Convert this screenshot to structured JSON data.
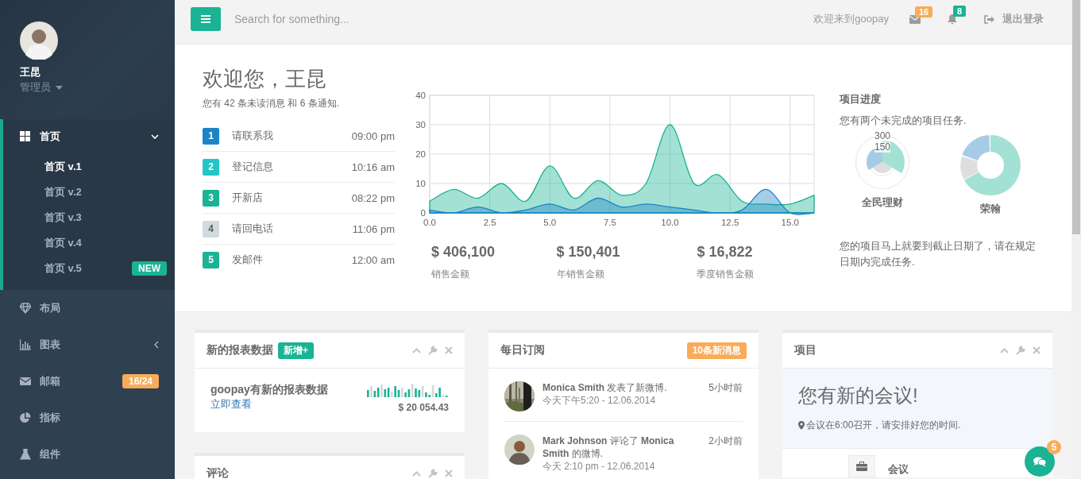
{
  "sidebar": {
    "profile": {
      "name": "王昆",
      "role": "管理员"
    },
    "menu": [
      {
        "label": "首页",
        "selected": true,
        "expanded": true,
        "children": [
          {
            "label": "首页 v.1",
            "selected": true
          },
          {
            "label": "首页 v.2",
            "selected": false
          },
          {
            "label": "首页 v.3",
            "selected": false
          },
          {
            "label": "首页 v.4",
            "selected": false
          },
          {
            "label": "首页 v.5",
            "selected": false,
            "badge": {
              "text": "NEW",
              "color": "#1ab394"
            }
          }
        ]
      },
      {
        "label": "布局",
        "selected": false
      },
      {
        "label": "图表",
        "selected": false,
        "expanded": false
      },
      {
        "label": "邮箱",
        "selected": false,
        "badge": {
          "text": "16/24",
          "color": "#f8ac59"
        }
      },
      {
        "label": "指标",
        "selected": false
      },
      {
        "label": "组件",
        "selected": false
      }
    ]
  },
  "topbar": {
    "search": {
      "placeholder": "Search for something..."
    },
    "welcome": "欢迎来到goopay",
    "mail_count": "16",
    "alert_count": "8",
    "logout": "退出登录"
  },
  "summary": {
    "title": "欢迎您，王昆",
    "subtitle": "您有 42 条未读消息 和 6 条通知.",
    "tasks": [
      {
        "number": "1",
        "label": "请联系我",
        "time": "09:00 pm",
        "color": "#1c84c6"
      },
      {
        "number": "2",
        "label": "登记信息",
        "time": "10:16 am",
        "color": "#23c6c8"
      },
      {
        "number": "3",
        "label": "开新店",
        "time": "08:22 pm",
        "color": "#1ab394"
      },
      {
        "number": "4",
        "label": "请回电话",
        "time": "11:06 pm",
        "color": "#d1dade"
      },
      {
        "number": "5",
        "label": "发邮件",
        "time": "12:00 am",
        "color": "#1ab394"
      }
    ],
    "chart_data": {
      "type": "area",
      "grid": true,
      "x": [
        0,
        1,
        2,
        3,
        4,
        5,
        6,
        7,
        8,
        9,
        10,
        11,
        12,
        13,
        14,
        15,
        16
      ],
      "xlim": [
        0,
        16
      ],
      "ylim": [
        0,
        40
      ],
      "xticks": [
        {
          "value": 0,
          "label": "0.0"
        },
        {
          "value": 2.5,
          "label": "2.5"
        },
        {
          "value": 5,
          "label": "5.0"
        },
        {
          "value": 7.5,
          "label": "7.5"
        },
        {
          "value": 10,
          "label": "10.0"
        },
        {
          "value": 12.5,
          "label": "12.5"
        },
        {
          "value": 15,
          "label": "15.0"
        }
      ],
      "yticks": [
        0,
        10,
        20,
        30,
        40
      ],
      "series": [
        {
          "color": "#1ab394",
          "values": [
            4,
            8,
            5,
            10,
            4,
            16,
            5,
            11,
            6,
            10,
            30,
            10,
            13,
            4,
            3,
            3,
            6
          ]
        },
        {
          "color": "#1c84c6",
          "values": [
            1,
            0,
            2,
            0,
            1,
            3,
            1,
            5,
            2,
            3,
            2,
            1,
            0,
            1,
            8,
            0,
            0
          ]
        }
      ]
    },
    "stats": [
      {
        "value": "$ 406,100",
        "label": "销售金额"
      },
      {
        "value": "$ 150,401",
        "label": "年销售金额"
      },
      {
        "value": "$ 16,822",
        "label": "季度销售金额"
      }
    ],
    "progress": {
      "title": "项目进度",
      "subtitle": "您有两个未完成的项目任务.",
      "charts": [
        {
          "kind": "polar",
          "label": "全民理财",
          "tick_labels": [
            "300",
            "150"
          ]
        },
        {
          "kind": "donut",
          "label": "荣翰"
        }
      ],
      "note": "您的项目马上就要到截止日期了，请在规定日期内完成任务."
    }
  },
  "columns": [
    {
      "panels": [
        {
          "kind": "report",
          "title": "新的报表数据",
          "label": {
            "text": "新增+",
            "color": "#1ab394"
          },
          "tools": true,
          "headline": "goopay有新的报表数据",
          "link": "立即查看",
          "amount": "$ 20 054.43"
        },
        {
          "kind": "plain",
          "title": "评论",
          "tools": true
        }
      ]
    },
    {
      "panels": [
        {
          "kind": "feed",
          "title": "每日订阅",
          "label": {
            "text": "10条新消息",
            "color": "#f8ac59"
          },
          "tools": false,
          "items": [
            {
              "text": "**Monica Smith** 发表了新微博.",
              "time": "5小时前",
              "date": "今天下午5:20 - 12.06.2014"
            },
            {
              "avatar": {
                "kind": "person"
              },
              "text": "**Mark Johnson** 评论了 **Monica Smith** 的微博.",
              "time": "2小时前",
              "date": "今天 2:10 pm - 12.06.2014"
            }
          ]
        }
      ]
    },
    {
      "panels": [
        {
          "kind": "project",
          "title": "项目",
          "tools": true,
          "alert": {
            "title": "您有新的会议!",
            "text": "会议在6:00召开，请安排好您的时间."
          },
          "timeline": [
            {
              "title": "会议"
            }
          ]
        }
      ]
    }
  ],
  "chat": {
    "count": "5"
  }
}
